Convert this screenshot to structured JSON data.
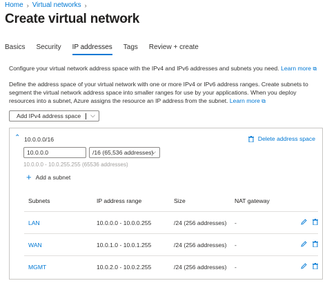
{
  "breadcrumb": {
    "items": [
      "Home",
      "Virtual networks"
    ]
  },
  "page": {
    "title": "Create virtual network",
    "more": "···"
  },
  "tabs": [
    "Basics",
    "Security",
    "IP addresses",
    "Tags",
    "Review + create"
  ],
  "active_tab": "IP addresses",
  "intro": {
    "text": "Configure your virtual network address space with the IPv4 and IPv6 addresses and subnets you need.",
    "link": "Learn more"
  },
  "define": {
    "text": "Define the address space of your virtual network with one or more IPv4 or IPv6 address ranges. Create subnets to segment the virtual network address space into smaller ranges for use by your applications. When you deploy resources into a subnet, Azure assigns the resource an IP address from the subnet.",
    "link": "Learn more"
  },
  "add_space_button": "Add IPv4 address space",
  "address_space": {
    "label": "10.0.0.0/16",
    "delete_label": "Delete address space",
    "ip_value": "10.0.0.0",
    "prefix_value": "/16 (65,536 addresses)",
    "range_hint": "10.0.0.0 - 10.0.255.255 (65536 addresses)",
    "add_subnet_label": "Add a subnet"
  },
  "subnet_table": {
    "headers": [
      "Subnets",
      "IP address range",
      "Size",
      "NAT gateway"
    ],
    "rows": [
      {
        "name": "LAN",
        "range": "10.0.0.0 - 10.0.0.255",
        "size": "/24 (256 addresses)",
        "nat": "-"
      },
      {
        "name": "WAN",
        "range": "10.0.1.0 - 10.0.1.255",
        "size": "/24 (256 addresses)",
        "nat": "-"
      },
      {
        "name": "MGMT",
        "range": "10.0.2.0 - 10.0.2.255",
        "size": "/24 (256 addresses)",
        "nat": "-"
      }
    ]
  },
  "colors": {
    "accent": "#0078d4",
    "text": "#323130",
    "border": "#c8c6c4"
  },
  "icons": [
    "external-link-icon",
    "chevron-down-icon",
    "chevron-up-icon",
    "trash-icon",
    "plus-icon",
    "edit-icon"
  ]
}
